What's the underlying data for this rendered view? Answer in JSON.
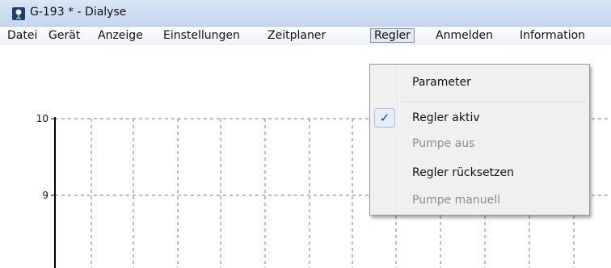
{
  "window": {
    "title": "G-193 * - Dialyse",
    "icon": "app-icon"
  },
  "menu": {
    "items": [
      {
        "label": "Datei"
      },
      {
        "label": "Gerät"
      },
      {
        "label": "Anzeige"
      },
      {
        "label": "Einstellungen"
      },
      {
        "label": "Zeitplaner"
      },
      {
        "label": "Regler",
        "open": true
      },
      {
        "label": "Anmelden"
      },
      {
        "label": "Information"
      }
    ]
  },
  "dropdown": {
    "items": [
      {
        "label": "Parameter",
        "enabled": true,
        "checked": false
      },
      {
        "label": "Regler aktiv",
        "enabled": true,
        "checked": true
      },
      {
        "label": "Pumpe aus",
        "enabled": false,
        "checked": false
      },
      {
        "label": "Regler rücksetzen",
        "enabled": true,
        "checked": false
      },
      {
        "label": "Pumpe manuell",
        "enabled": false,
        "checked": false
      }
    ],
    "check_mark": "✓"
  },
  "chart_data": {
    "type": "line",
    "yticks": [
      "10",
      "9"
    ],
    "grid": true,
    "grid_style": "dashed",
    "series": []
  },
  "colors": {
    "titlebar": "#c4d7ee",
    "menu_open_border": "#7f90ad",
    "axis": "#000000",
    "grid": "#7a7a7a"
  }
}
